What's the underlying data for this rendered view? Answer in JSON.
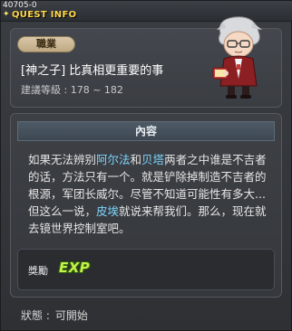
{
  "window": {
    "id": "40705-0",
    "title": "QUEST INFO"
  },
  "quest": {
    "job_badge": "職業",
    "name": "[神之子] 比真相更重要的事",
    "required_level": "建議等級 : 178 ~ 182"
  },
  "content": {
    "section_title": "內容",
    "description_parts": {
      "p1": "如果无法辨别",
      "name1": "阿尔法",
      "p2": "和",
      "name2": "贝塔",
      "p3": "两者之中谁是不吉者的话，方法只有一个。就是铲除掉制造不吉者的根源，军团长威尔。尽管不知道可能性有多大...但这么一说，",
      "name3": "皮埃",
      "p4": "就说来帮我们。那么，现在就去镜世界控制室吧。"
    }
  },
  "reward": {
    "label": "獎勵",
    "icon": "exp-icon",
    "icon_text": "EXP"
  },
  "status": {
    "label": "狀態 :",
    "value": "可開始"
  },
  "colors": {
    "title": "#ffd84a",
    "highlight": "#7fd6ff",
    "exp": "#c7f24a"
  }
}
